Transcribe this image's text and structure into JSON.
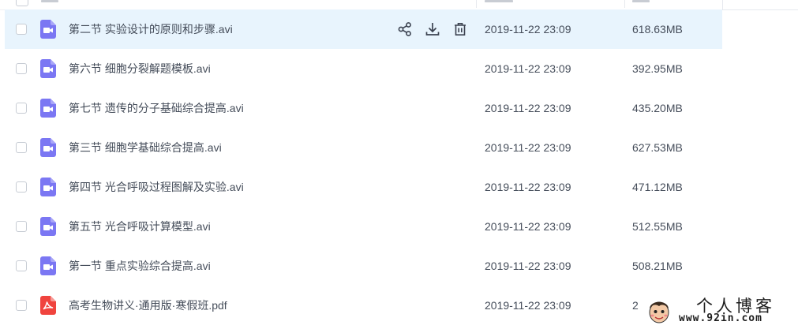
{
  "colors": {
    "hover_row": "#e8f4fd",
    "video_icon": "#7b77f3",
    "pdf_icon": "#f0443e",
    "text": "#454d5a"
  },
  "actions": {
    "share_icon": "share-icon",
    "download_icon": "download-icon",
    "delete_icon": "trash-icon"
  },
  "files": [
    {
      "name": "第二节 实验设计的原则和步骤.avi",
      "date": "2019-11-22 23:09",
      "size": "618.63MB",
      "type": "video",
      "hovered": true
    },
    {
      "name": "第六节 细胞分裂解题模板.avi",
      "date": "2019-11-22 23:09",
      "size": "392.95MB",
      "type": "video"
    },
    {
      "name": "第七节 遗传的分子基础综合提高.avi",
      "date": "2019-11-22 23:09",
      "size": "435.20MB",
      "type": "video"
    },
    {
      "name": "第三节 细胞学基础综合提高.avi",
      "date": "2019-11-22 23:09",
      "size": "627.53MB",
      "type": "video"
    },
    {
      "name": "第四节 光合呼吸过程图解及实验.avi",
      "date": "2019-11-22 23:09",
      "size": "471.12MB",
      "type": "video"
    },
    {
      "name": "第五节 光合呼吸计算模型.avi",
      "date": "2019-11-22 23:09",
      "size": "512.55MB",
      "type": "video"
    },
    {
      "name": "第一节 重点实验综合提高.avi",
      "date": "2019-11-22 23:09",
      "size": "508.21MB",
      "type": "video"
    },
    {
      "name": "高考生物讲义·通用版·寒假班.pdf",
      "date": "2019-11-22 23:09",
      "size": "2",
      "type": "pdf"
    }
  ],
  "watermark": {
    "title": "个人博客",
    "url": "www.92in.com"
  }
}
